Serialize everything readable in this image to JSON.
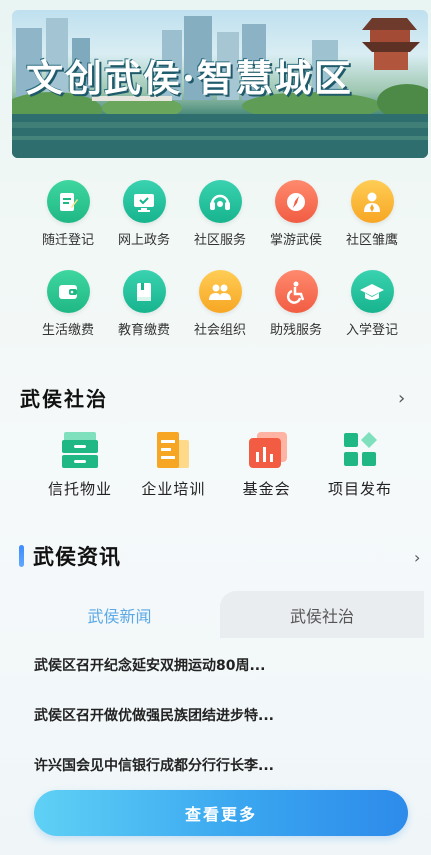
{
  "banner": {
    "title": "文创武侯·智慧城区"
  },
  "services": {
    "row1": [
      {
        "label": "随迁登记",
        "icon": "pencil-note-icon",
        "color": "green"
      },
      {
        "label": "网上政务",
        "icon": "monitor-check-icon",
        "color": "teal"
      },
      {
        "label": "社区服务",
        "icon": "headset-icon",
        "color": "teal"
      },
      {
        "label": "掌游武侯",
        "icon": "compass-icon",
        "color": "red"
      },
      {
        "label": "社区雏鹰",
        "icon": "person-tie-icon",
        "color": "orange"
      }
    ],
    "row2": [
      {
        "label": "生活缴费",
        "icon": "wallet-icon",
        "color": "green"
      },
      {
        "label": "教育缴费",
        "icon": "book-icon",
        "color": "teal"
      },
      {
        "label": "社会组织",
        "icon": "people-icon",
        "color": "orange"
      },
      {
        "label": "助残服务",
        "icon": "wheelchair-icon",
        "color": "red"
      },
      {
        "label": "入学登记",
        "icon": "graduation-cap-icon",
        "color": "teal"
      }
    ]
  },
  "governance": {
    "title": "武侯社治",
    "chevron": "›",
    "items": [
      {
        "label": "信托物业",
        "icon": "cabinet-icon"
      },
      {
        "label": "企业培训",
        "icon": "document-bars-icon"
      },
      {
        "label": "基金会",
        "icon": "bar-chart-icon"
      },
      {
        "label": "项目发布",
        "icon": "grid-diamond-icon"
      }
    ]
  },
  "news": {
    "title": "武侯资讯",
    "chevron": "›",
    "tabs": [
      "武侯新闻",
      "武侯社治"
    ],
    "items": [
      "武侯区召开纪念延安双拥运动80周...",
      "武侯区召开做优做强民族团结进步特...",
      "许兴国会见中信银行成都分行行长李..."
    ],
    "more_label": "查看更多"
  },
  "colors": {
    "accent_blue": "#5aa8e6",
    "green": "#1fb884",
    "orange": "#f7a623",
    "red": "#f15c42"
  }
}
